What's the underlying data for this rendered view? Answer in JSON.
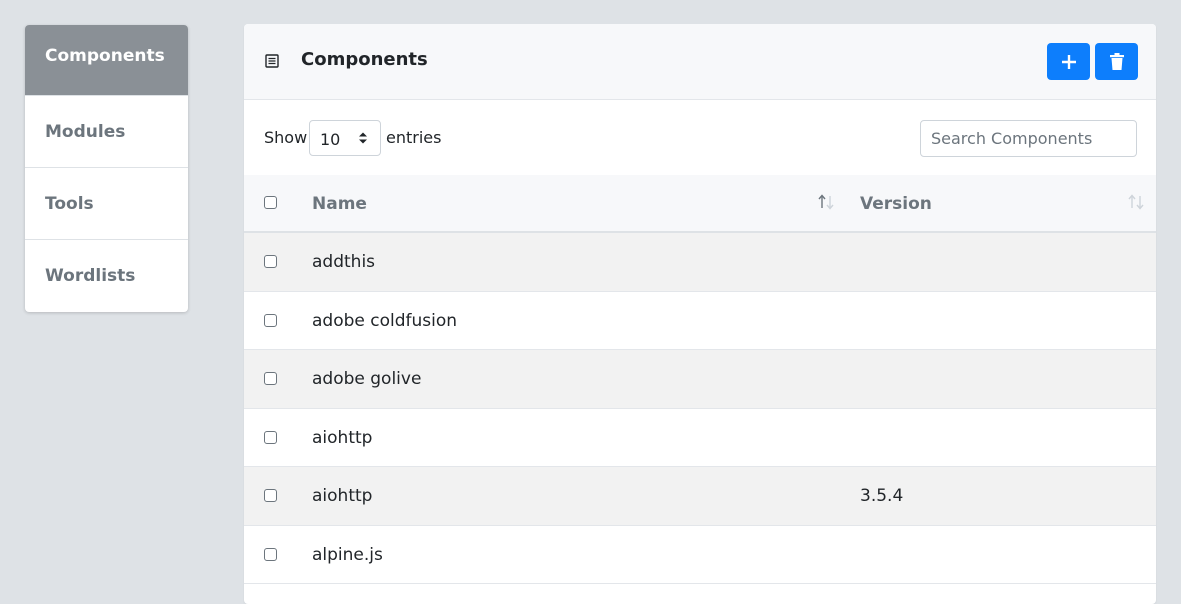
{
  "sidebar": {
    "items": [
      {
        "label": "Components",
        "active": true
      },
      {
        "label": "Modules",
        "active": false
      },
      {
        "label": "Tools",
        "active": false
      },
      {
        "label": "Wordlists",
        "active": false
      }
    ]
  },
  "card": {
    "title": "Components",
    "title_icon": "list-icon",
    "add_icon": "plus-icon",
    "delete_icon": "trash-icon"
  },
  "controls": {
    "show_label": "Show",
    "entries_value": "10",
    "entries_label": "entries",
    "search_placeholder": "Search Components"
  },
  "table": {
    "headers": {
      "name": "Name",
      "version": "Version"
    },
    "rows": [
      {
        "name": "addthis",
        "version": ""
      },
      {
        "name": "adobe coldfusion",
        "version": ""
      },
      {
        "name": "adobe golive",
        "version": ""
      },
      {
        "name": "aiohttp",
        "version": ""
      },
      {
        "name": "aiohttp",
        "version": "3.5.4"
      },
      {
        "name": "alpine.js",
        "version": ""
      }
    ]
  },
  "colors": {
    "accent": "#0d7efc",
    "sidebar_active": "#8a9096",
    "page_bg": "#dee2e6"
  }
}
